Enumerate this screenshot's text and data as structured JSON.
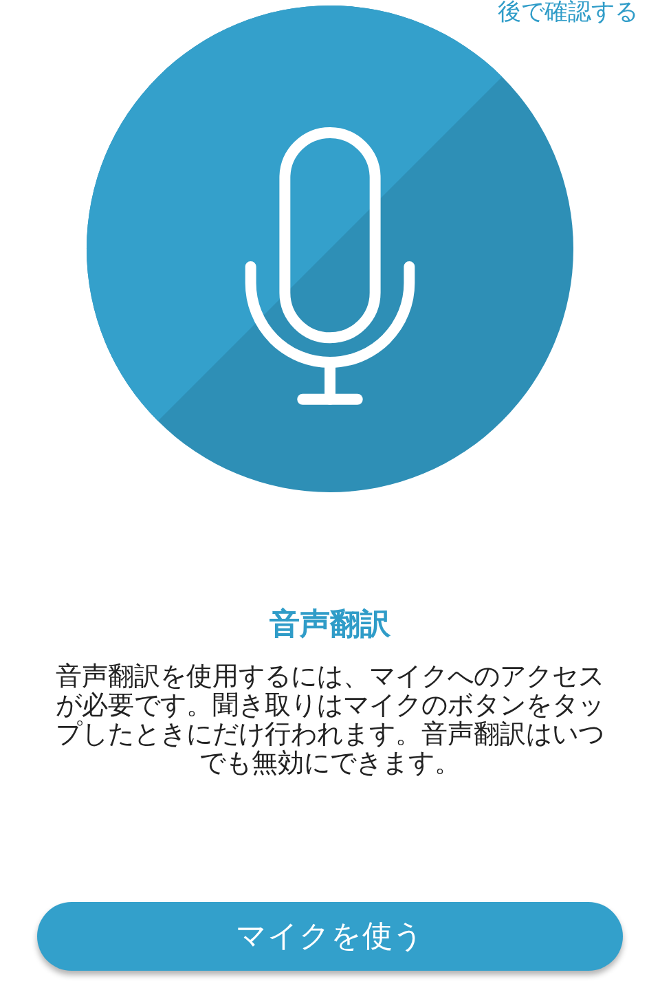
{
  "later_link": "後で確認する",
  "title": "音声翻訳",
  "description": "音声翻訳を使用するには、マイクへのアクセスが必要です。聞き取りはマイクのボタンをタップしたときにだけ行われます。音声翻訳はいつでも無効にできます。",
  "button": "マイクを使う"
}
